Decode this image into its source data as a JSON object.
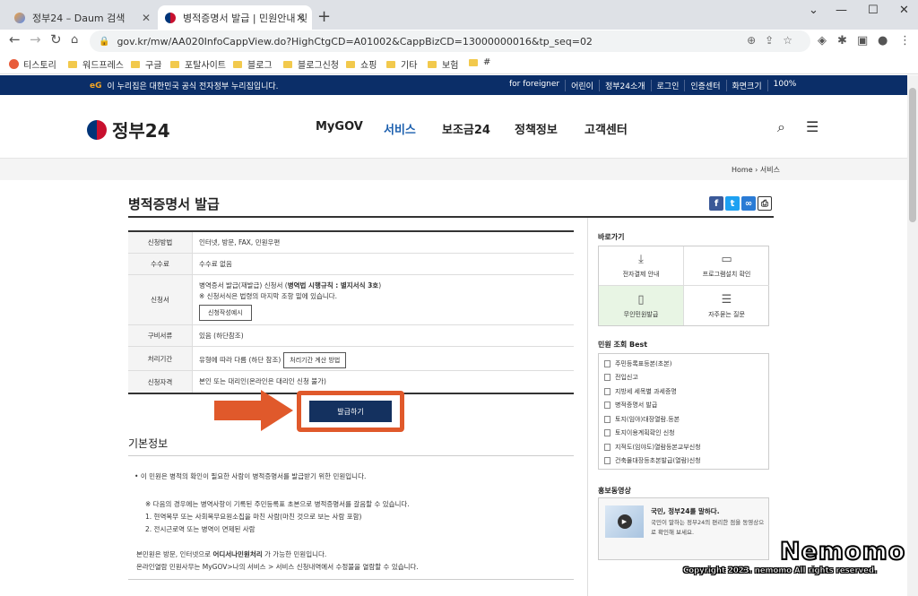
{
  "browser": {
    "tabs": [
      {
        "label": "정부24 – Daum 검색",
        "active": false
      },
      {
        "label": "병적증명서 발급 | 민원안내 및 ",
        "active": true
      }
    ],
    "url": "gov.kr/mw/AA020InfoCappView.do?HighCtgCD=A01002&CappBizCD=13000000016&tp_seq=02",
    "bookmarks": [
      "티스토리",
      "워드프레스",
      "구글",
      "포탈사이트",
      "블로그",
      "블로그신청",
      "쇼핑",
      "기타",
      "보험",
      "#"
    ]
  },
  "govbar": {
    "notice": "이 누리집은 대한민국 공식 전자정부 누리집입니다.",
    "links": [
      "for foreigner",
      "어린이",
      "정부24소개",
      "로그인",
      "인증센터",
      "화면크기"
    ],
    "zoom": "100%"
  },
  "header": {
    "brand": "정부24",
    "nav": [
      "MyGOV",
      "서비스",
      "보조금24",
      "정책정보",
      "고객센터"
    ],
    "active_nav": "서비스"
  },
  "breadcrumb": {
    "home": "Home",
    "current": "서비스"
  },
  "main": {
    "title": "병적증명서 발급",
    "rows": {
      "method_label": "신청방법",
      "method": "인터넷, 방문, FAX, 민원우편",
      "fee_label": "수수료",
      "fee": "수수료 없음",
      "form_label": "신청서",
      "form_line1_pre": "병역증서 발급(재발급) 신청서 (",
      "form_line1_bold": "병역법 시행규칙 : 별지서식 3호",
      "form_line1_post": ")",
      "form_line2": "※ 신청서식은 법령의 마지막 조항 밑에 있습니다.",
      "form_button": "신청작성예시",
      "docs_label": "구비서류",
      "docs": "있음 (하단참조)",
      "period_label": "처리기간",
      "period": "유형에 따라 다름 (하단 참조)",
      "period_button": "처리기간 계산 방법",
      "qual_label": "신청자격",
      "qual": "본인 또는 대리인(온라인은 대리인 신청 불가)"
    },
    "issue_button": "발급하기",
    "section_title": "기본정보",
    "basic": {
      "line1": "이 민원은 병적의 확인이 필요한 사람이 병적증명서를 발급받기 위한 민원입니다.",
      "line2": "※ 다음의 경우에는 병역사항이 기록된 주민등록표 초본으로 병적증명서를 갈음할 수 있습니다.",
      "line3": "1. 현역복무 또는 사회복무요원소집을 마친 사람(마친 것으로 보는 사람 포함)",
      "line4": "2. 전시근로역 또는 병역이 면제된 사람",
      "line5_pre": "본민원은 방문, 인터넷으로 ",
      "line5_bold": "어디서나민원처리",
      "line5_post": " 가 가능한 민원입니다.",
      "line6": "온라인열람 민원사무는 MyGOV>나의 서비스 > 서비스 신청내역에서 수정불을 열람할 수 있습니다."
    }
  },
  "sidebar": {
    "quick_title": "바로가기",
    "quick": [
      "전자결제 안내",
      "프로그램설치 확인",
      "무인민원발급",
      "자주묻는 질문"
    ],
    "best_title": "민원 조회 Best",
    "best": [
      "주민등록표등본(초본)",
      "전입신고",
      "지방세 세목별 과세증명",
      "병적증명서 발급",
      "토지(임야)대장열람.등본",
      "토지이용계획확인 신청",
      "지적도(임야도)열람등본교부신청",
      "건축물대장등초본발급(열람)신청"
    ],
    "promo_title": "홍보동영상",
    "promo_heading": "국민, 정부24를 말하다.",
    "promo_desc": "국민이 말하는 정부24의 편리한 점을 동영상으로 확인해 보세요."
  },
  "watermark": {
    "name": "Nemomo",
    "copyright": "Copyright 2023. nemomo All rights reserved."
  }
}
